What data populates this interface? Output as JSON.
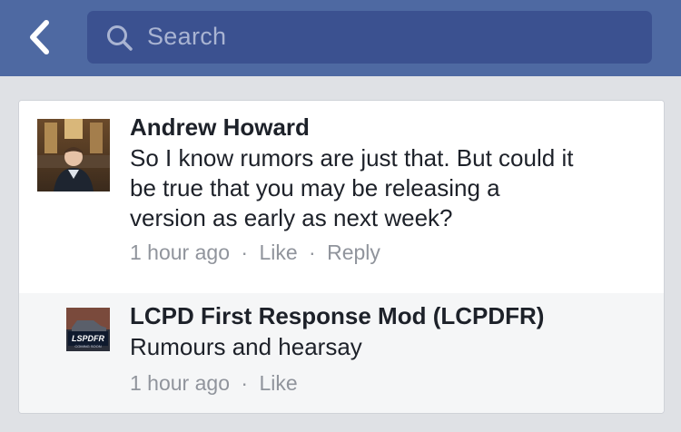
{
  "search": {
    "placeholder": "Search"
  },
  "comment": {
    "author": "Andrew Howard",
    "text_lines": [
      "So I know rumors are just that. But could it",
      "be true that you may be releasing a",
      "version as early as next week?"
    ],
    "time": "1 hour ago",
    "like_label": "Like",
    "reply_label": "Reply"
  },
  "reply": {
    "author": "LCPD First Response Mod (LCPDFR)",
    "text": "Rumours and hearsay",
    "time": "1 hour ago",
    "like_label": "Like",
    "avatar_text": "LSPDFR",
    "avatar_subtext": "COMING SOON"
  },
  "icons": {
    "back": "chevron-left-icon",
    "search": "search-icon"
  },
  "colors": {
    "header": "#4e69a2",
    "search_field": "#3b5190",
    "meta_text": "#90949c",
    "reply_background": "#f5f6f7"
  },
  "separator": "·"
}
